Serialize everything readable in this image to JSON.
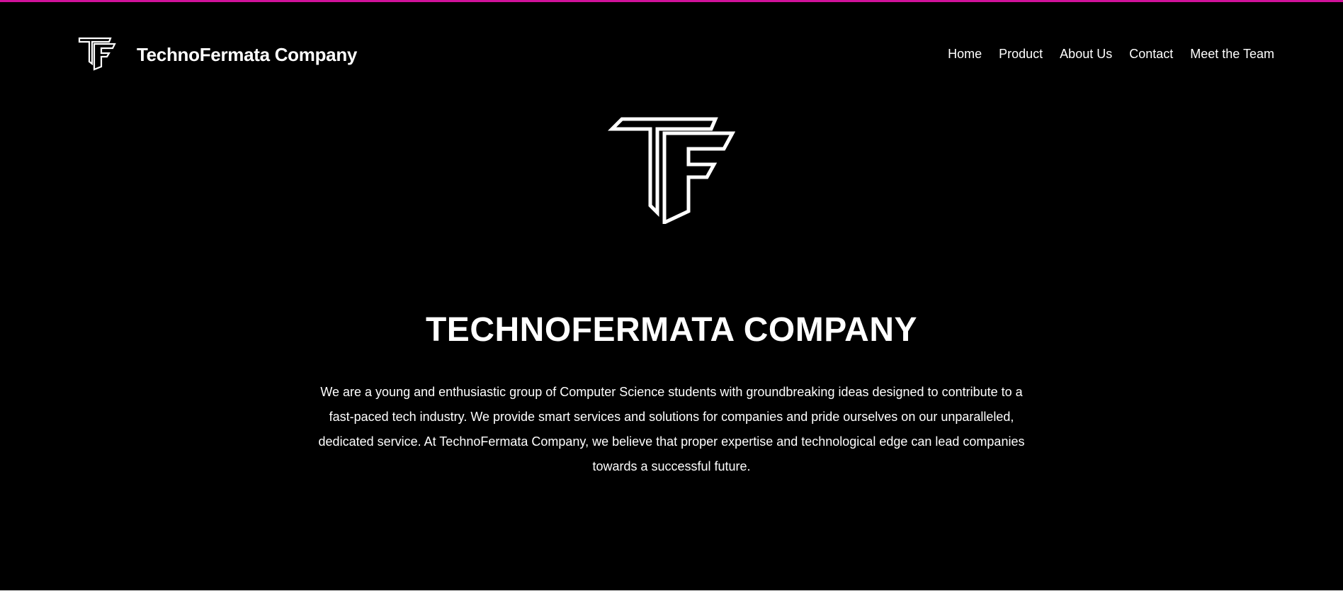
{
  "accent_color": "#d0129a",
  "background_color": "#000000",
  "header": {
    "logo_icon": "tf-monogram-icon",
    "brand_name": "TechnoFermata Company",
    "nav": [
      "Home",
      "Product",
      "About Us",
      "Contact",
      "Meet the Team"
    ]
  },
  "hero": {
    "logo_icon": "tf-monogram-icon",
    "title": "TECHNOFERMATA COMPANY",
    "description": "We are a young and enthusiastic group of Computer Science students with groundbreaking ideas designed to contribute to a fast-paced tech industry. We provide smart services and solutions for companies and pride ourselves on our unparalleled, dedicated service. At TechnoFermata Company, we believe that proper expertise and technological edge can lead companies towards a successful future."
  }
}
